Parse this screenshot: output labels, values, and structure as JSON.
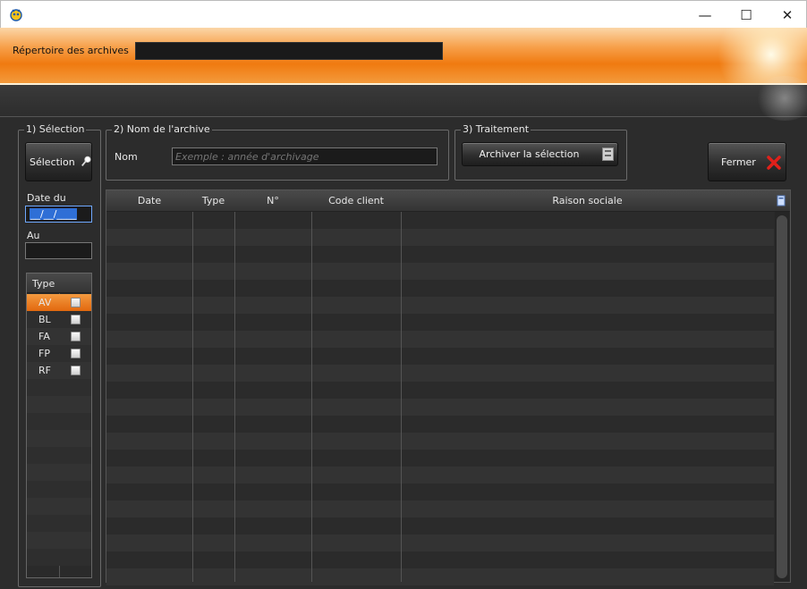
{
  "window": {
    "minimize": "—",
    "maximize": "☐",
    "close": "✕"
  },
  "header": {
    "repo_label": "Répertoire des archives",
    "repo_value": ""
  },
  "selection": {
    "legend": "1) Sélection",
    "button_label": "Sélection",
    "date_from_label": "Date du",
    "date_from_value": "__/__/____",
    "date_to_label": "Au",
    "date_to_value": ""
  },
  "types": {
    "header": "Type",
    "items": [
      {
        "code": "AV",
        "checked": false,
        "selected": true
      },
      {
        "code": "BL",
        "checked": false,
        "selected": false
      },
      {
        "code": "FA",
        "checked": false,
        "selected": false
      },
      {
        "code": "FP",
        "checked": false,
        "selected": false
      },
      {
        "code": "RF",
        "checked": false,
        "selected": false
      }
    ]
  },
  "archive_name": {
    "legend": "2) Nom de l'archive",
    "label": "Nom",
    "placeholder": "Exemple : année d'archivage"
  },
  "processing": {
    "legend": "3) Traitement",
    "button_label": "Archiver la sélection"
  },
  "close_button": {
    "label": "Fermer"
  },
  "table": {
    "columns": [
      "Date",
      "Type",
      "N°",
      "Code client",
      "Raison sociale"
    ],
    "rows": []
  },
  "colors": {
    "accent": "#f07a10",
    "selection": "#e8731a",
    "close_x": "#e0201a"
  }
}
